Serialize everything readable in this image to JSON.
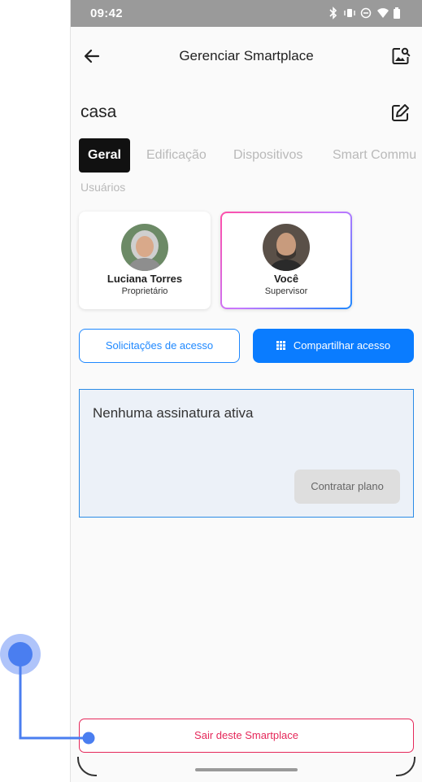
{
  "status_bar": {
    "time": "09:42"
  },
  "app_bar": {
    "title": "Gerenciar Smartplace"
  },
  "place": {
    "name": "casa"
  },
  "tabs": [
    {
      "label": "Geral",
      "active": true
    },
    {
      "label": "Edificação",
      "active": false
    },
    {
      "label": "Dispositivos",
      "active": false
    },
    {
      "label": "Smart Commu",
      "active": false
    },
    {
      "label": "Usuários",
      "active": false
    }
  ],
  "members": [
    {
      "name": "Luciana  Torres",
      "role": "Proprietário"
    },
    {
      "name": "Você",
      "role": "Supervisor"
    }
  ],
  "actions": {
    "requests_label": "Solicitações de acesso",
    "share_label": "Compartilhar acesso"
  },
  "subscription": {
    "title": "Nenhuma assinatura ativa",
    "button_label": "Contratar plano"
  },
  "exit": {
    "label": "Sair deste Smartplace"
  },
  "colors": {
    "primary": "#0a7cff",
    "danger": "#e5285a",
    "touch_indicator": "#4a7ef0"
  },
  "icons": [
    "back-arrow-icon",
    "image-search-icon",
    "edit-icon",
    "grid-icon",
    "bluetooth-icon",
    "vibrate-icon",
    "dnd-icon",
    "wifi-icon",
    "battery-icon"
  ]
}
